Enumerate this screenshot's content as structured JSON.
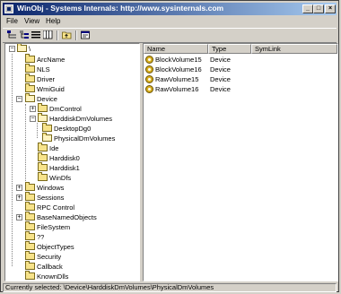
{
  "window": {
    "title": "WinObj - Systems Internals: http://www.sysinternals.com",
    "minimize": "_",
    "maximize": "□",
    "close": "×"
  },
  "menu": {
    "file": "File",
    "view": "View",
    "help": "Help"
  },
  "toolbar": {
    "icons": [
      "tree-view-icon",
      "hierarchy-icon",
      "list-icon",
      "details-icon",
      "folder-up-icon",
      "properties-icon"
    ]
  },
  "tree": {
    "root": "\\",
    "items": [
      {
        "label": "ArcName",
        "depth": 1
      },
      {
        "label": "NLS",
        "depth": 1
      },
      {
        "label": "Driver",
        "depth": 1
      },
      {
        "label": "WmiGuid",
        "depth": 1
      },
      {
        "label": "Device",
        "depth": 1
      },
      {
        "label": "DmControl",
        "depth": 2
      },
      {
        "label": "HarddiskDmVolumes",
        "depth": 2
      },
      {
        "label": "DesktopDg0",
        "depth": 3
      },
      {
        "label": "PhysicalDmVolumes",
        "depth": 3
      },
      {
        "label": "Ide",
        "depth": 2
      },
      {
        "label": "Harddisk0",
        "depth": 2
      },
      {
        "label": "Harddisk1",
        "depth": 2
      },
      {
        "label": "WinDfs",
        "depth": 2
      },
      {
        "label": "Windows",
        "depth": 1
      },
      {
        "label": "Sessions",
        "depth": 1
      },
      {
        "label": "RPC Control",
        "depth": 1
      },
      {
        "label": "BaseNamedObjects",
        "depth": 1
      },
      {
        "label": "FileSystem",
        "depth": 1
      },
      {
        "label": "??",
        "depth": 1
      },
      {
        "label": "ObjectTypes",
        "depth": 1
      },
      {
        "label": "Security",
        "depth": 1
      },
      {
        "label": "Callback",
        "depth": 1
      },
      {
        "label": "KnownDlls",
        "depth": 1
      }
    ]
  },
  "list": {
    "columns": [
      "Name",
      "Type",
      "SymLink"
    ],
    "rows": [
      {
        "name": "BlockVolume15",
        "type": "Device",
        "symlink": ""
      },
      {
        "name": "BlockVolume16",
        "type": "Device",
        "symlink": ""
      },
      {
        "name": "RawVolume15",
        "type": "Device",
        "symlink": ""
      },
      {
        "name": "RawVolume16",
        "type": "Device",
        "symlink": ""
      }
    ]
  },
  "status": {
    "text": "Currently selected:  \\Device\\HarddiskDmVolumes\\PhysicalDmVolumes"
  }
}
